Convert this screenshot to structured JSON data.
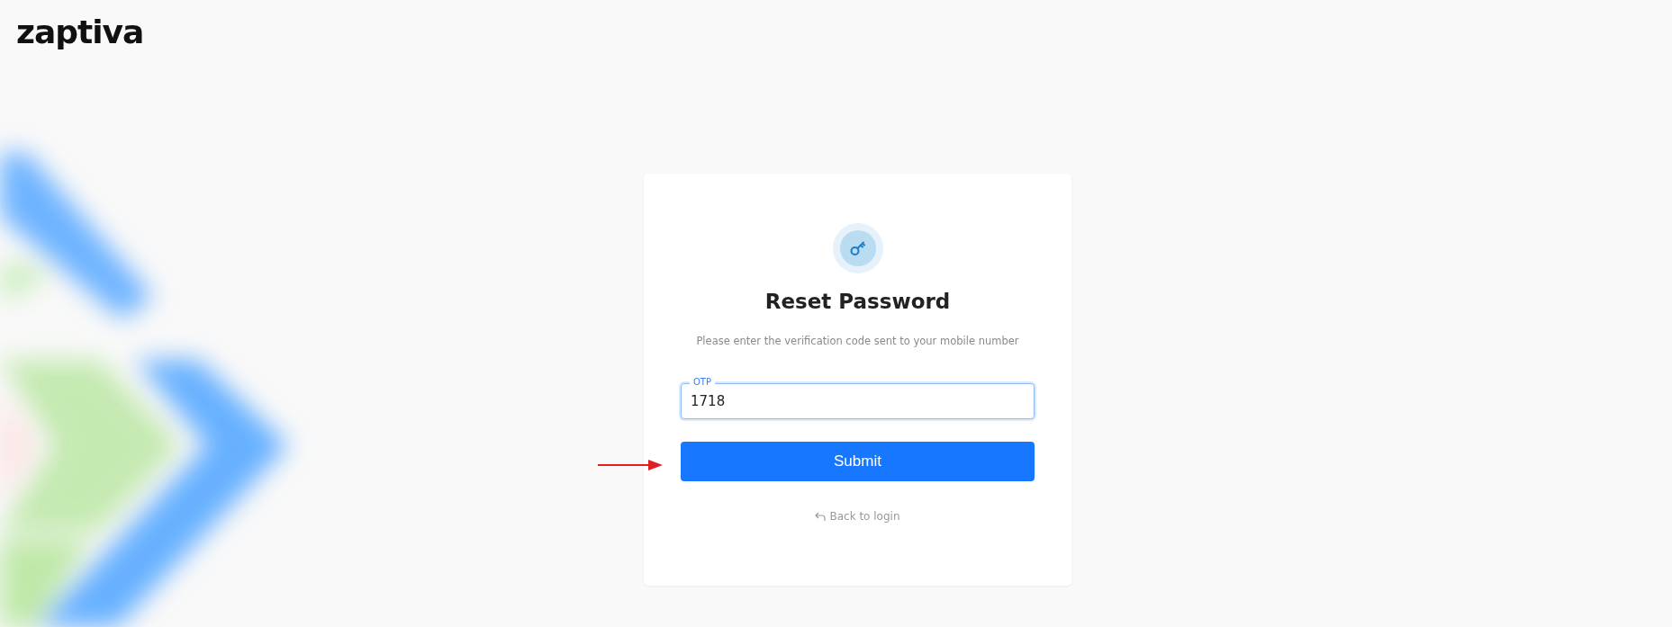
{
  "logo": {
    "text": "zaptiva"
  },
  "card": {
    "title": "Reset Password",
    "subtitle": "Please enter the verification code sent to your mobile number",
    "otp_field": {
      "label": "OTP",
      "value": "1718"
    },
    "submit_button": "Submit",
    "back_link": "Back to login"
  }
}
